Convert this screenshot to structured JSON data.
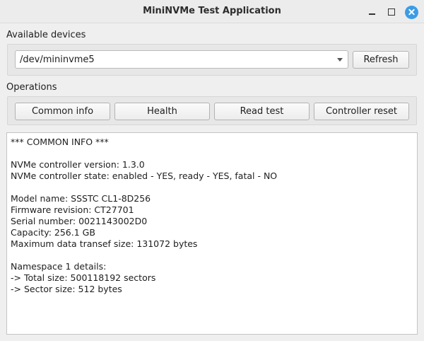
{
  "window": {
    "title": "MiniNVMe Test Application"
  },
  "devices": {
    "label": "Available devices",
    "selected": "/dev/mininvme5",
    "refresh_label": "Refresh"
  },
  "operations": {
    "label": "Operations",
    "buttons": [
      "Common info",
      "Health",
      "Read test",
      "Controller reset"
    ]
  },
  "output": {
    "lines": [
      "*** COMMON INFO ***",
      "",
      "NVMe controller version: 1.3.0",
      "NVMe controller state: enabled - YES, ready - YES, fatal - NO",
      "",
      "Model name: SSSTC CL1-8D256",
      "Firmware revision: CT27701",
      "Serial number: 0021143002D0",
      "Capacity: 256.1 GB",
      "Maximum data transef size: 131072 bytes",
      "",
      "Namespace 1 details:",
      "-> Total size: 500118192 sectors",
      "-> Sector size: 512 bytes"
    ]
  },
  "colors": {
    "close_button": "#3b9ce6",
    "window_bg": "#efefef"
  }
}
